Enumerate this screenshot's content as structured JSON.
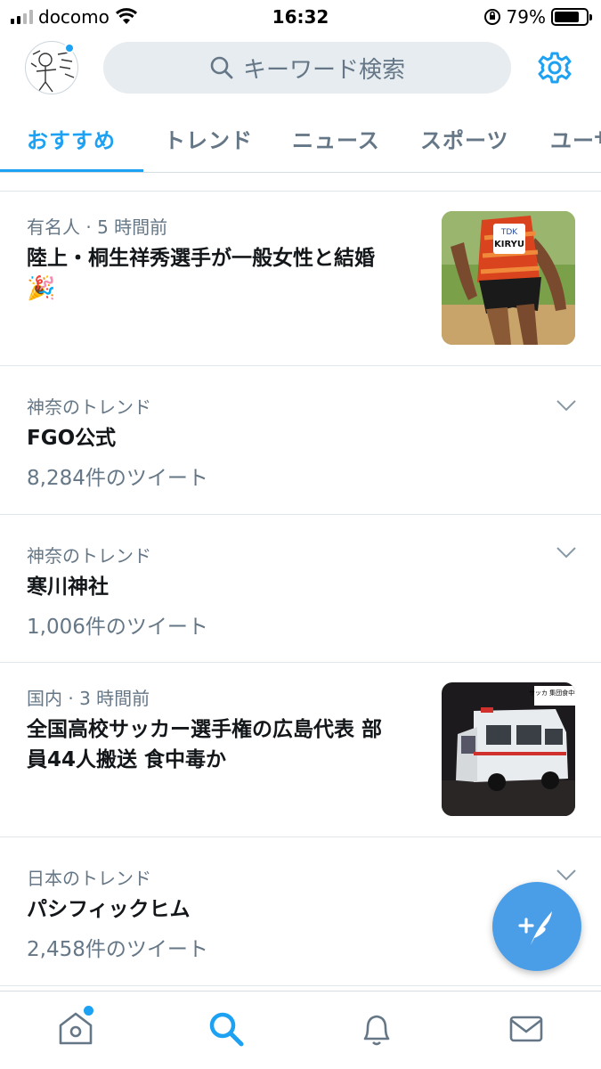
{
  "status_bar": {
    "carrier": "docomo",
    "time": "16:32",
    "battery_percent": "79%",
    "battery_level": 0.79
  },
  "header": {
    "search_placeholder": "キーワード検索"
  },
  "tabs": [
    {
      "label": "おすすめ",
      "active": true
    },
    {
      "label": "トレンド",
      "active": false
    },
    {
      "label": "ニュース",
      "active": false
    },
    {
      "label": "スポーツ",
      "active": false
    },
    {
      "label": "ユーザ",
      "active": false
    }
  ],
  "feed": [
    {
      "meta": "有名人 · 5 時間前",
      "title_line1": "陸上・桐生祥秀選手が一般女性と結婚",
      "emoji": "🎉",
      "thumb": "athlete-kiryu",
      "thumb_text": "KIRYU",
      "thumb_logo": "TDK"
    },
    {
      "meta": "神奈のトレンド",
      "title": "FGO公式",
      "count": "8,284件のツイート"
    },
    {
      "meta": "神奈のトレンド",
      "title": "寒川神社",
      "count": "1,006件のツイート"
    },
    {
      "meta": "国内 · 3 時間前",
      "title_line1": "全国高校サッカー選手権の広島代表 部",
      "title_line2": "員44人搬送 食中毒か",
      "thumb": "ambulance",
      "thumb_caption": "サッカ 集団食中毒"
    },
    {
      "meta": "日本のトレンド",
      "title": "パシフィックヒム",
      "count": "2,458件のツイート"
    }
  ],
  "colors": {
    "accent": "#1da1f2",
    "secondary_text": "#657786",
    "primary_text": "#14171a"
  },
  "icons": [
    "search-icon",
    "gear-icon",
    "chevron-down-icon",
    "compose-icon",
    "home-icon",
    "explore-search-icon",
    "bell-icon",
    "mail-icon"
  ]
}
